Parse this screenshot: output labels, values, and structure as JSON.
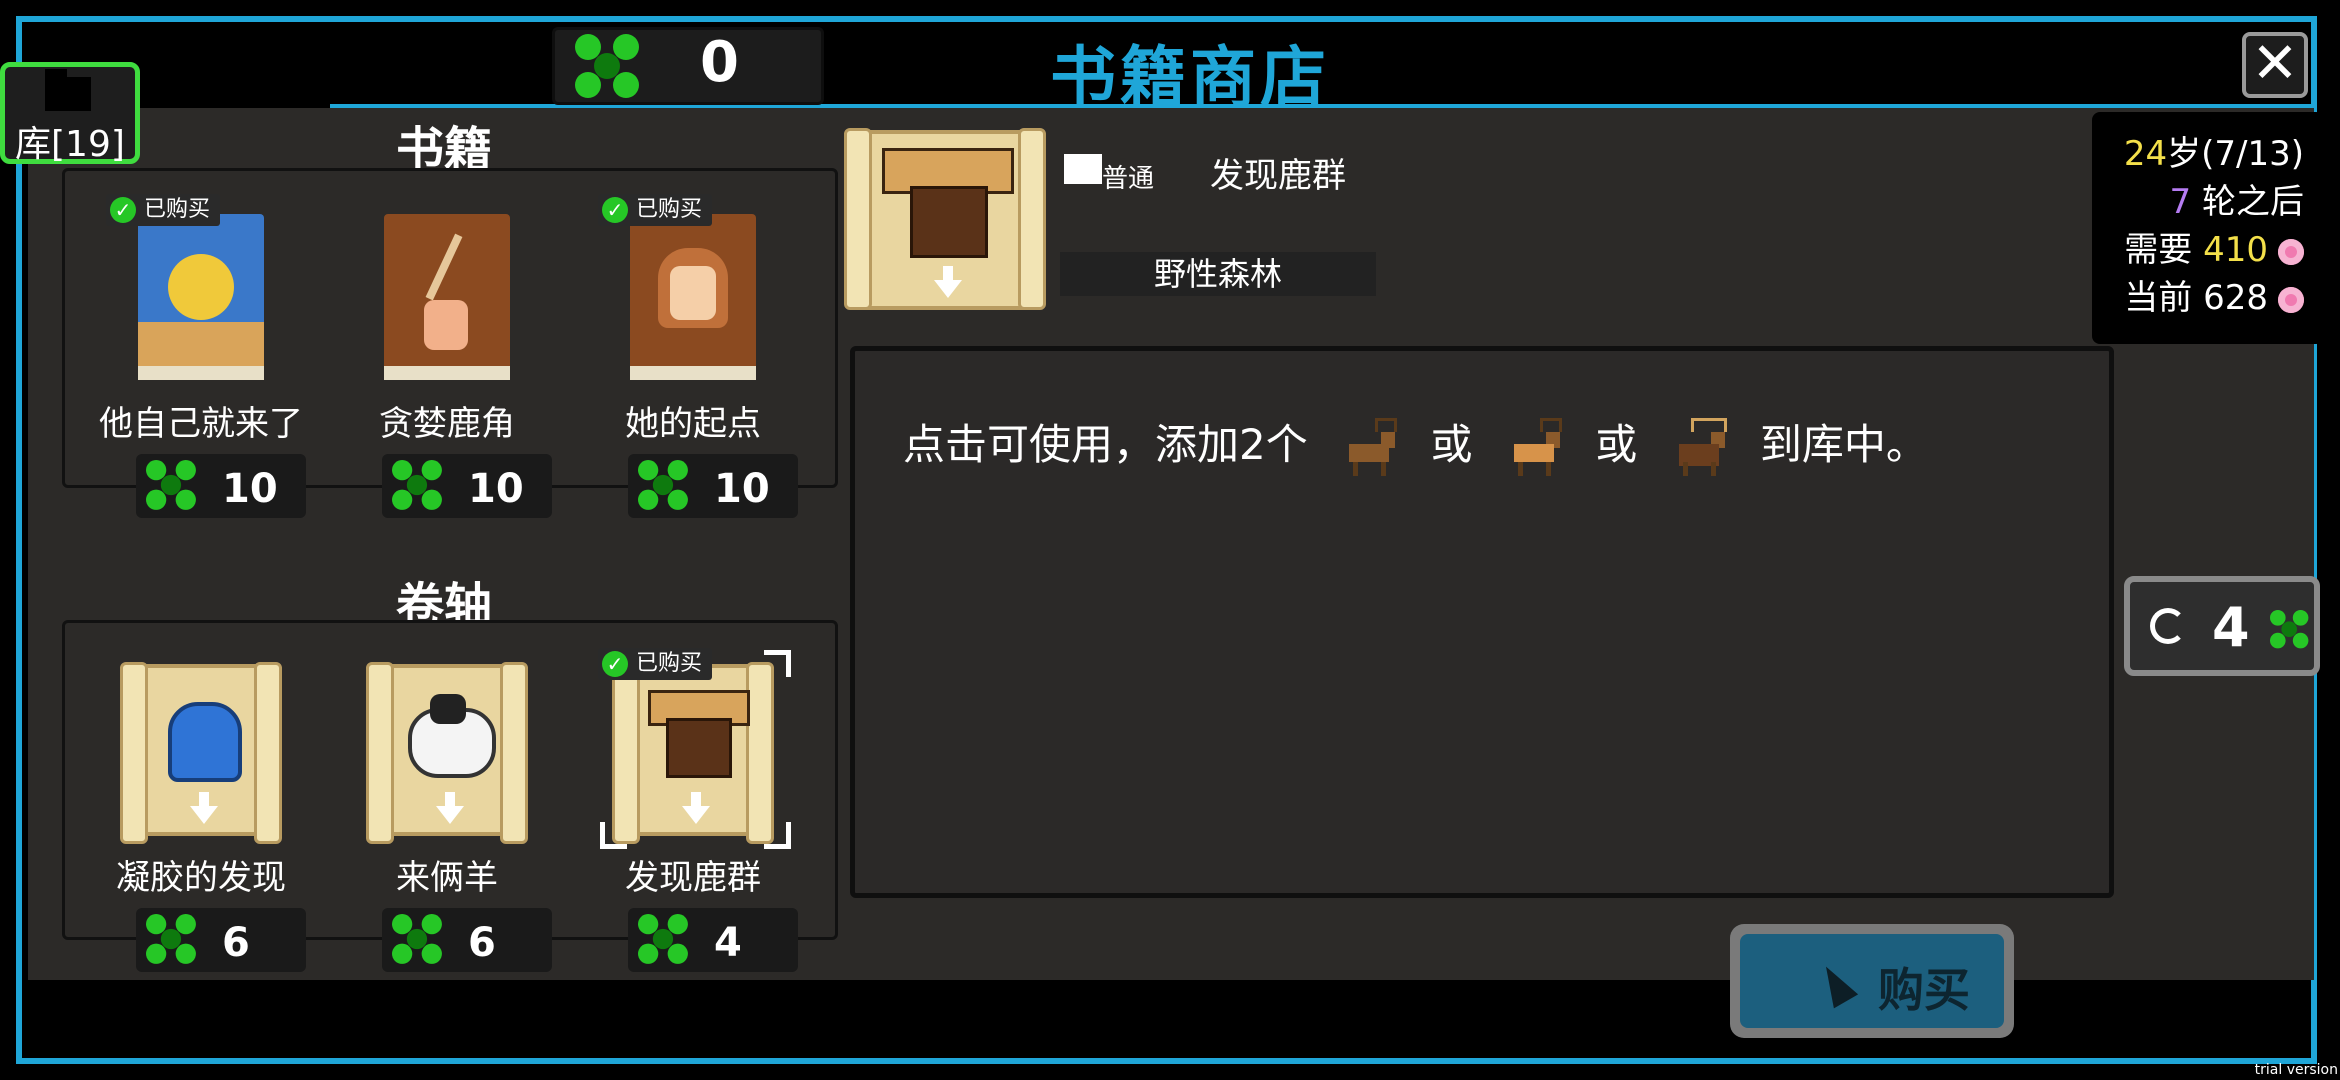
{
  "header": {
    "currency_count": "0",
    "title": "书籍商店",
    "close_glyph": "✕"
  },
  "library": {
    "label": "库[19]"
  },
  "books": {
    "title": "书籍",
    "items": [
      {
        "name": "他自己就来了",
        "price": "10",
        "bought": true,
        "bought_label": "已购买",
        "cover_color": "#3a78c9"
      },
      {
        "name": "贪婪鹿角",
        "price": "10",
        "bought": false,
        "cover_color": "#8b4a20"
      },
      {
        "name": "她的起点",
        "price": "10",
        "bought": true,
        "bought_label": "已购买",
        "cover_color": "#8b4a20"
      }
    ]
  },
  "scrolls": {
    "title": "卷轴",
    "items": [
      {
        "name": "凝胶的发现",
        "price": "6",
        "bought": false
      },
      {
        "name": "来俩羊",
        "price": "6",
        "bought": false
      },
      {
        "name": "发现鹿群",
        "price": "4",
        "bought": true,
        "bought_label": "已购买",
        "selected": true
      }
    ]
  },
  "detail": {
    "rarity": "普通",
    "name": "发现鹿群",
    "place": "野性森林",
    "description": {
      "prefix": "点击可使用，添加2个",
      "or1": "或",
      "or2": "或",
      "suffix": "到库中。"
    },
    "icons": [
      "deer-icon",
      "spotted-deer-icon",
      "moose-icon"
    ]
  },
  "status": {
    "age": "24",
    "age_unit": "岁",
    "age_progress": "(7/13)",
    "turns": "7",
    "turns_label": "轮之后",
    "need_label": "需要",
    "need_value": "410",
    "current_label": "当前",
    "current_value": "628"
  },
  "refresh": {
    "count": "4"
  },
  "buy": {
    "label": "购买"
  },
  "watermark": "trial version",
  "colors": {
    "accent": "#1fa6d8",
    "clover": "#26c726",
    "lib_border": "#3fdc3f",
    "age": "#f4e04a",
    "turns": "#b57cf2",
    "flower": "#f07ab0"
  }
}
